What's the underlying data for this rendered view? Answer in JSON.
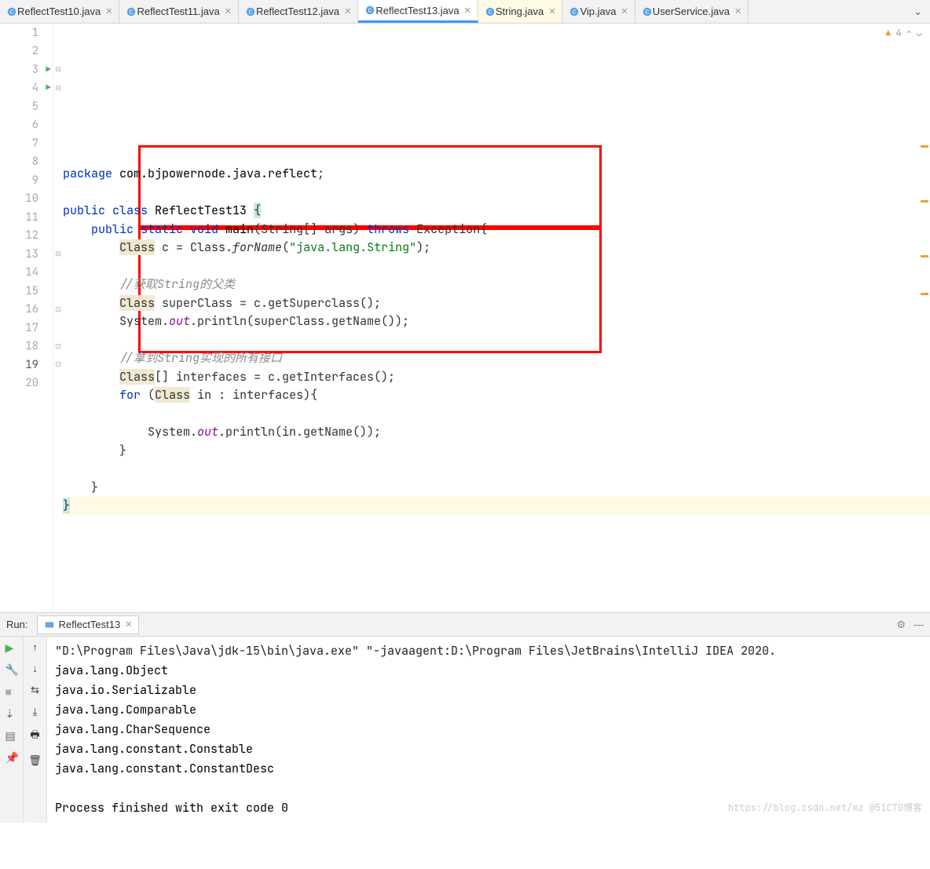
{
  "tabs": [
    {
      "name": "ReflectTest10.java",
      "active": false
    },
    {
      "name": "ReflectTest11.java",
      "active": false
    },
    {
      "name": "ReflectTest12.java",
      "active": false
    },
    {
      "name": "ReflectTest13.java",
      "active": true
    },
    {
      "name": "String.java",
      "active": false,
      "hl": true
    },
    {
      "name": "Vip.java",
      "active": false
    },
    {
      "name": "UserService.java",
      "active": false
    }
  ],
  "warnings": {
    "count": "4"
  },
  "lines": [
    {
      "n": "1",
      "code": [
        [
          "kw",
          "package "
        ],
        [
          "cls",
          "com.bjpowernode.java.reflect"
        ],
        [
          "",
          "; "
        ]
      ]
    },
    {
      "n": "2",
      "code": []
    },
    {
      "n": "3",
      "run": true,
      "code": [
        [
          "kw",
          "public class "
        ],
        [
          "cls",
          "ReflectTest13 "
        ],
        [
          "hl-end",
          "{"
        ]
      ]
    },
    {
      "n": "4",
      "run": true,
      "code": [
        [
          "",
          "    "
        ],
        [
          "kw",
          "public static "
        ],
        [
          "kw",
          "void "
        ],
        [
          "cls",
          "main"
        ],
        [
          "",
          "(String[] args) "
        ],
        [
          "kw",
          "throws "
        ],
        [
          "",
          "Exception{"
        ]
      ]
    },
    {
      "n": "5",
      "code": [
        [
          "",
          "        "
        ],
        [
          "hl-cls",
          "Class"
        ],
        [
          "",
          " c = Class."
        ],
        [
          "mth",
          "forName"
        ],
        [
          "",
          "("
        ],
        [
          "str",
          "\"java.lang.String\""
        ],
        [
          "",
          ");"
        ]
      ]
    },
    {
      "n": "6",
      "code": []
    },
    {
      "n": "7",
      "code": [
        [
          "",
          "        "
        ],
        [
          "com",
          "//获取String的父类"
        ]
      ]
    },
    {
      "n": "8",
      "code": [
        [
          "",
          "        "
        ],
        [
          "hl-cls",
          "Class"
        ],
        [
          "",
          " superClass = c.getSuperclass();"
        ]
      ]
    },
    {
      "n": "9",
      "code": [
        [
          "",
          "        System."
        ],
        [
          "fld",
          "out"
        ],
        [
          "",
          ".println(superClass.getName());"
        ]
      ]
    },
    {
      "n": "10",
      "code": []
    },
    {
      "n": "11",
      "code": [
        [
          "",
          "        "
        ],
        [
          "com",
          "//拿到String实现的所有接口"
        ]
      ]
    },
    {
      "n": "12",
      "code": [
        [
          "",
          "        "
        ],
        [
          "hl-cls",
          "Class"
        ],
        [
          "",
          "[] interfaces = c.getInterfaces();"
        ]
      ]
    },
    {
      "n": "13",
      "code": [
        [
          "",
          "        "
        ],
        [
          "kw",
          "for "
        ],
        [
          "",
          "("
        ],
        [
          "hl-cls",
          "Class"
        ],
        [
          "",
          " in : interfaces){"
        ]
      ]
    },
    {
      "n": "14",
      "code": []
    },
    {
      "n": "15",
      "code": [
        [
          "",
          "            System."
        ],
        [
          "fld",
          "out"
        ],
        [
          "",
          ".println(in.getName());"
        ]
      ]
    },
    {
      "n": "16",
      "code": [
        [
          "",
          "        "
        ],
        [
          "",
          "}"
        ]
      ]
    },
    {
      "n": "17",
      "code": []
    },
    {
      "n": "18",
      "code": [
        [
          "",
          "    "
        ],
        [
          "",
          "}"
        ]
      ]
    },
    {
      "n": "19",
      "hl": true,
      "code": [
        [
          "hl-end",
          "}"
        ]
      ]
    },
    {
      "n": "20",
      "code": []
    }
  ],
  "run": {
    "label": "Run:",
    "tab": "ReflectTest13",
    "cmd": "\"D:\\Program Files\\Java\\jdk-15\\bin\\java.exe\" \"-javaagent:D:\\Program Files\\JetBrains\\IntelliJ IDEA 2020.",
    "output": [
      "java.lang.Object",
      "java.io.Serializable",
      "java.lang.Comparable",
      "java.lang.CharSequence",
      "java.lang.constant.Constable",
      "java.lang.constant.ConstantDesc"
    ],
    "finish": "Process finished with exit code 0"
  },
  "watermark": "https://blog.csdn.net/mz @51CTO博客"
}
